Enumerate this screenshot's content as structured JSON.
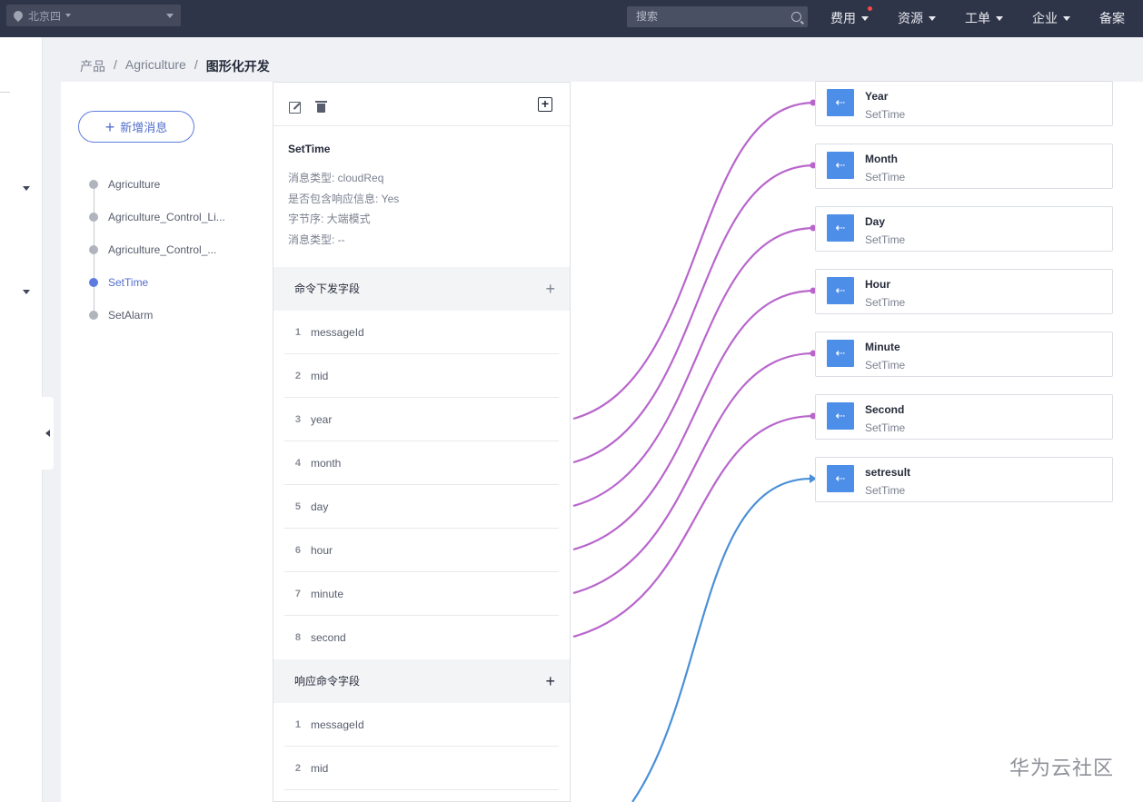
{
  "topbar": {
    "region": "北京四",
    "search_placeholder": "搜索",
    "nav": [
      "费用",
      "资源",
      "工单",
      "企业",
      "备案"
    ]
  },
  "breadcrumb": [
    "产品",
    "Agriculture",
    "图形化开发"
  ],
  "add_message_button": "新增消息",
  "tree": [
    {
      "label": "Agriculture",
      "active": false
    },
    {
      "label": "Agriculture_Control_Li...",
      "active": false
    },
    {
      "label": "Agriculture_Control_...",
      "active": false
    },
    {
      "label": "SetTime",
      "active": true
    },
    {
      "label": "SetAlarm",
      "active": false
    }
  ],
  "message": {
    "name": "SetTime",
    "type": "消息类型: cloudReq",
    "has_response": "是否包含响应信息: Yes",
    "byte_order": "字节序: 大端模式",
    "type2": "消息类型: --"
  },
  "command_section": {
    "title": "命令下发字段",
    "fields": [
      {
        "num": "1",
        "name": "messageId"
      },
      {
        "num": "2",
        "name": "mid"
      },
      {
        "num": "3",
        "name": "year"
      },
      {
        "num": "4",
        "name": "month"
      },
      {
        "num": "5",
        "name": "day"
      },
      {
        "num": "6",
        "name": "hour"
      },
      {
        "num": "7",
        "name": "minute"
      },
      {
        "num": "8",
        "name": "second"
      }
    ]
  },
  "response_section": {
    "title": "响应命令字段",
    "fields": [
      {
        "num": "1",
        "name": "messageId"
      },
      {
        "num": "2",
        "name": "mid"
      }
    ]
  },
  "cards": [
    {
      "name": "Year",
      "sub": "SetTime"
    },
    {
      "name": "Month",
      "sub": "SetTime"
    },
    {
      "name": "Day",
      "sub": "SetTime"
    },
    {
      "name": "Hour",
      "sub": "SetTime"
    },
    {
      "name": "Minute",
      "sub": "SetTime"
    },
    {
      "name": "Second",
      "sub": "SetTime"
    },
    {
      "name": "setresult",
      "sub": "SetTime"
    }
  ],
  "colors": {
    "link_request": "#b866cc",
    "link_response": "#4a8fd8",
    "accent": "#5e7ce0"
  },
  "watermark": "华为云社区"
}
